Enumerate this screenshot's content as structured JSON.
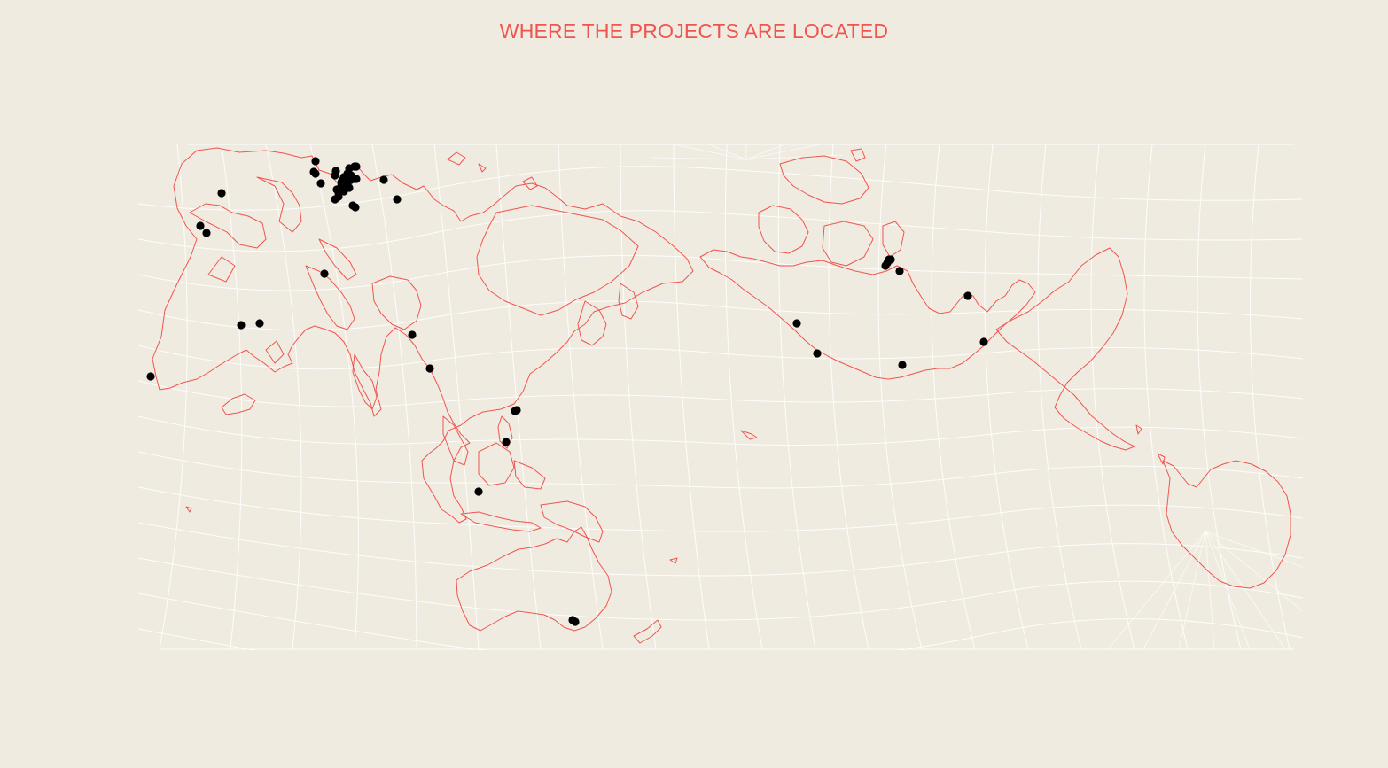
{
  "title": "WHERE THE PROJECTS ARE LOCATED",
  "colors": {
    "background": "#f0ebe0",
    "title": "#f0544f",
    "coastline": "#f0544f",
    "graticule": "#ffffff",
    "marker": "#000000"
  },
  "project_count": 56
}
